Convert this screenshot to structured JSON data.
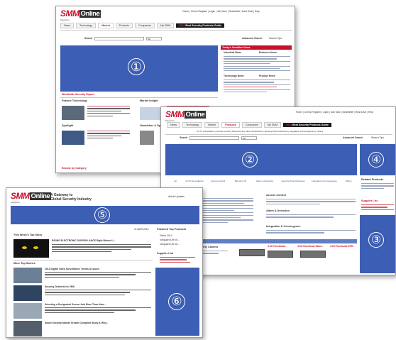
{
  "page1": {
    "logo": "SMM",
    "logo_suffix": "Online",
    "logo_tagline": "Magazine",
    "top_links": "Home | Check Register | Login | Join Now | Newsletter | Best Deal | Help",
    "tabs": [
      "News",
      "Technology",
      "Market",
      "Products",
      "Companies",
      "My SMM"
    ],
    "active_tab": "Market",
    "guide_button": "Best Security Products Guide",
    "guide_prefix": "2014",
    "search_label": "Search",
    "search_select": "All",
    "advanced_search": "Advanced Search",
    "search_help": "Search Tips",
    "headline_box_title": "Today's Headline News",
    "headline_columns": [
      "Industrial News",
      "Business News"
    ],
    "headline_columns_2": [
      "Technology News",
      "Product News"
    ],
    "region_label": "①",
    "feature_caption": "Worldwide Security Report",
    "section_titles": [
      "Feature Technology",
      "Market Insight",
      "Spotlight",
      "Newsletter & Opt"
    ],
    "footer_link": "Browse by Category"
  },
  "page2": {
    "logo": "SMM",
    "logo_suffix": "Online",
    "logo_tagline": "Magazine",
    "top_links": "Home | Check Register | Login | Join Now | Newsletter | Best Deal | Help",
    "tabs": [
      "News",
      "Technology",
      "Market",
      "Products",
      "Companies",
      "My SMM"
    ],
    "active_tab": "Products",
    "guide_button": "Best Security Products Guide",
    "guide_prefix": "2014",
    "subnav": "CCTV Surveillance | Access Control | Biometric ID | Alarm & Detection | Security Parts & Devices | Integration & Convergence | Others",
    "search_label": "Search",
    "search_select": "All",
    "advanced_search": "Advanced Search",
    "search_help": "Search Tips",
    "region_labels": [
      "②",
      "④",
      "③"
    ],
    "categories": [
      "All",
      "CCTV Surveillance",
      "Access Control",
      "Biometric ID",
      "Alarm & Detection",
      "Security Parts & Devices",
      "Integration & Convergence",
      "Others"
    ],
    "listing_heading_1": "Access Control",
    "listing_heading_2": "Alarm & Detection",
    "listing_heading_3": "Integration & Convergence",
    "new_products_title": "Security Camera",
    "product_names": [
      "4-CH Functional...",
      "4-CH Functional Stand...",
      "4-CH Functional DVR..."
    ],
    "right_heading": "Related Products",
    "right_heading_2": "Supplier List"
  },
  "page3": {
    "logo": "SMM",
    "logo_suffix": "Online",
    "logo_tagline": "Magazine",
    "title_line_1": "A Gateway to",
    "title_line_2": "Global Security Industry",
    "top_right_link": "Article Updates",
    "region_labels": [
      "⑤",
      "⑥"
    ],
    "date": "11.MAR.2014",
    "top_story_heading": "This Week's Top Story",
    "top_story_title": "RISING ELECTRONIC SURVEILLANCE Right Before U...",
    "more_heading": "More Top Stories",
    "stories": [
      "2014 Digital Video Surveillance Trends & Issues",
      "Security Delivered to VMS",
      "Selecting a Designated Sensor And More Than How...",
      "Smart Security Market Growth Compiled Study & Why..."
    ],
    "side_heading_1": "Featured Top Products",
    "side_items_1": [
      "Vision 2014",
      "Vanguard Life Ut...",
      "Vanguard Life Ut..."
    ],
    "side_heading_2": "Supplier List"
  },
  "colors": {
    "brand_red": "#c8102e",
    "region_blue": "#3c5eb4",
    "guide_black": "#1a1a1a"
  }
}
